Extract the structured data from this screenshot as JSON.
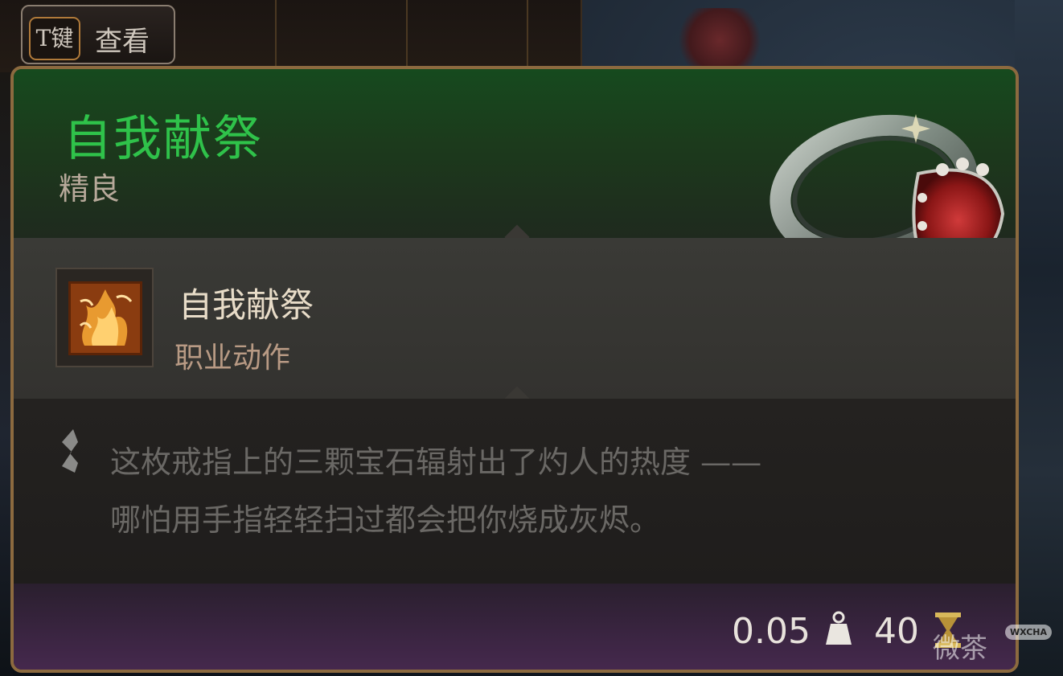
{
  "hint": {
    "key": "T键",
    "label": "查看"
  },
  "item": {
    "name": "自我献祭",
    "rarity": "精良"
  },
  "action": {
    "name": "自我献祭",
    "type": "职业动作"
  },
  "description": {
    "line1": "这枚戒指上的三颗宝石辐射出了灼人的热度 ——",
    "line2": "哪怕用手指轻轻扫过都会把你烧成灰烬。"
  },
  "stats": {
    "weight": "0.05",
    "price": "40"
  },
  "watermark": {
    "cn": "微茶",
    "en": "WXCHA"
  },
  "colors": {
    "name": "#2fc24a",
    "border": "#8c6a3f",
    "header": "#164a1e",
    "footer": "#46294e"
  },
  "icons": {
    "ring": "ring-item-icon",
    "action": "flame-scroll-icon",
    "quote": "quote-marker-icon",
    "weight": "weight-icon",
    "price": "price-icon"
  }
}
